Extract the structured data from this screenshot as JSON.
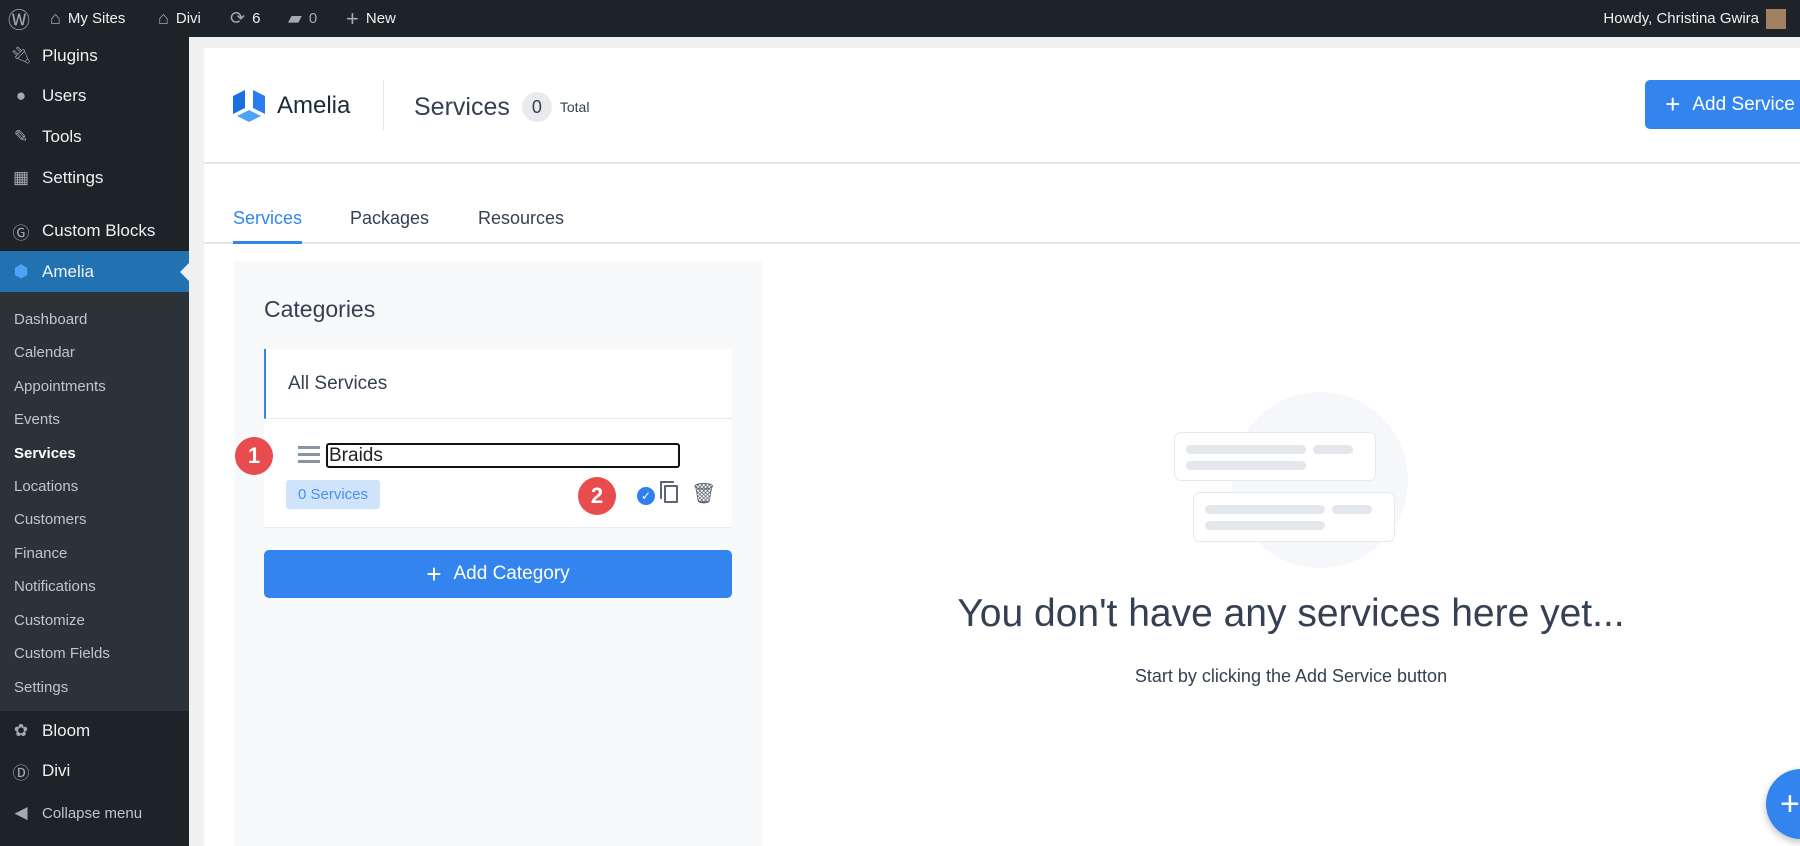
{
  "topbar": {
    "my_sites": "My Sites",
    "site": "Divi",
    "updates": "6",
    "comments": "0",
    "new": "New",
    "howdy": "Howdy, Christina Gwira"
  },
  "sidebar": {
    "items": [
      {
        "label": "Plugins",
        "icon": "plug-icon"
      },
      {
        "label": "Users",
        "icon": "user-icon"
      },
      {
        "label": "Tools",
        "icon": "wrench-icon"
      },
      {
        "label": "Settings",
        "icon": "settings-icon"
      },
      {
        "label": "Custom Blocks",
        "icon": "blocks-icon"
      },
      {
        "label": "Amelia",
        "icon": "amelia-icon"
      }
    ],
    "submenu": [
      "Dashboard",
      "Calendar",
      "Appointments",
      "Events",
      "Services",
      "Locations",
      "Customers",
      "Finance",
      "Notifications",
      "Customize",
      "Custom Fields",
      "Settings"
    ],
    "current": "Services",
    "bottom": [
      {
        "label": "Bloom",
        "icon": "bloom-icon"
      },
      {
        "label": "Divi",
        "icon": "divi-icon"
      },
      {
        "label": "Collapse menu",
        "icon": "collapse-icon"
      }
    ]
  },
  "header": {
    "logo": "Amelia",
    "title": "Services",
    "count": "0",
    "count_label": "Total",
    "add_button": "Add Service"
  },
  "tabs": [
    {
      "label": "Services",
      "active": true
    },
    {
      "label": "Packages"
    },
    {
      "label": "Resources"
    }
  ],
  "categories": {
    "title": "Categories",
    "all": "All Services",
    "editing": {
      "value": "Braids",
      "badge": "0 Services"
    },
    "add_button": "Add Category"
  },
  "annotations": [
    "1",
    "2"
  ],
  "empty": {
    "heading": "You don't have any services here yet...",
    "sub": "Start by clicking the Add Service button"
  },
  "colors": {
    "accent": "#3384ef",
    "wp_active": "#2271b1",
    "annotation": "#e84c4c"
  }
}
